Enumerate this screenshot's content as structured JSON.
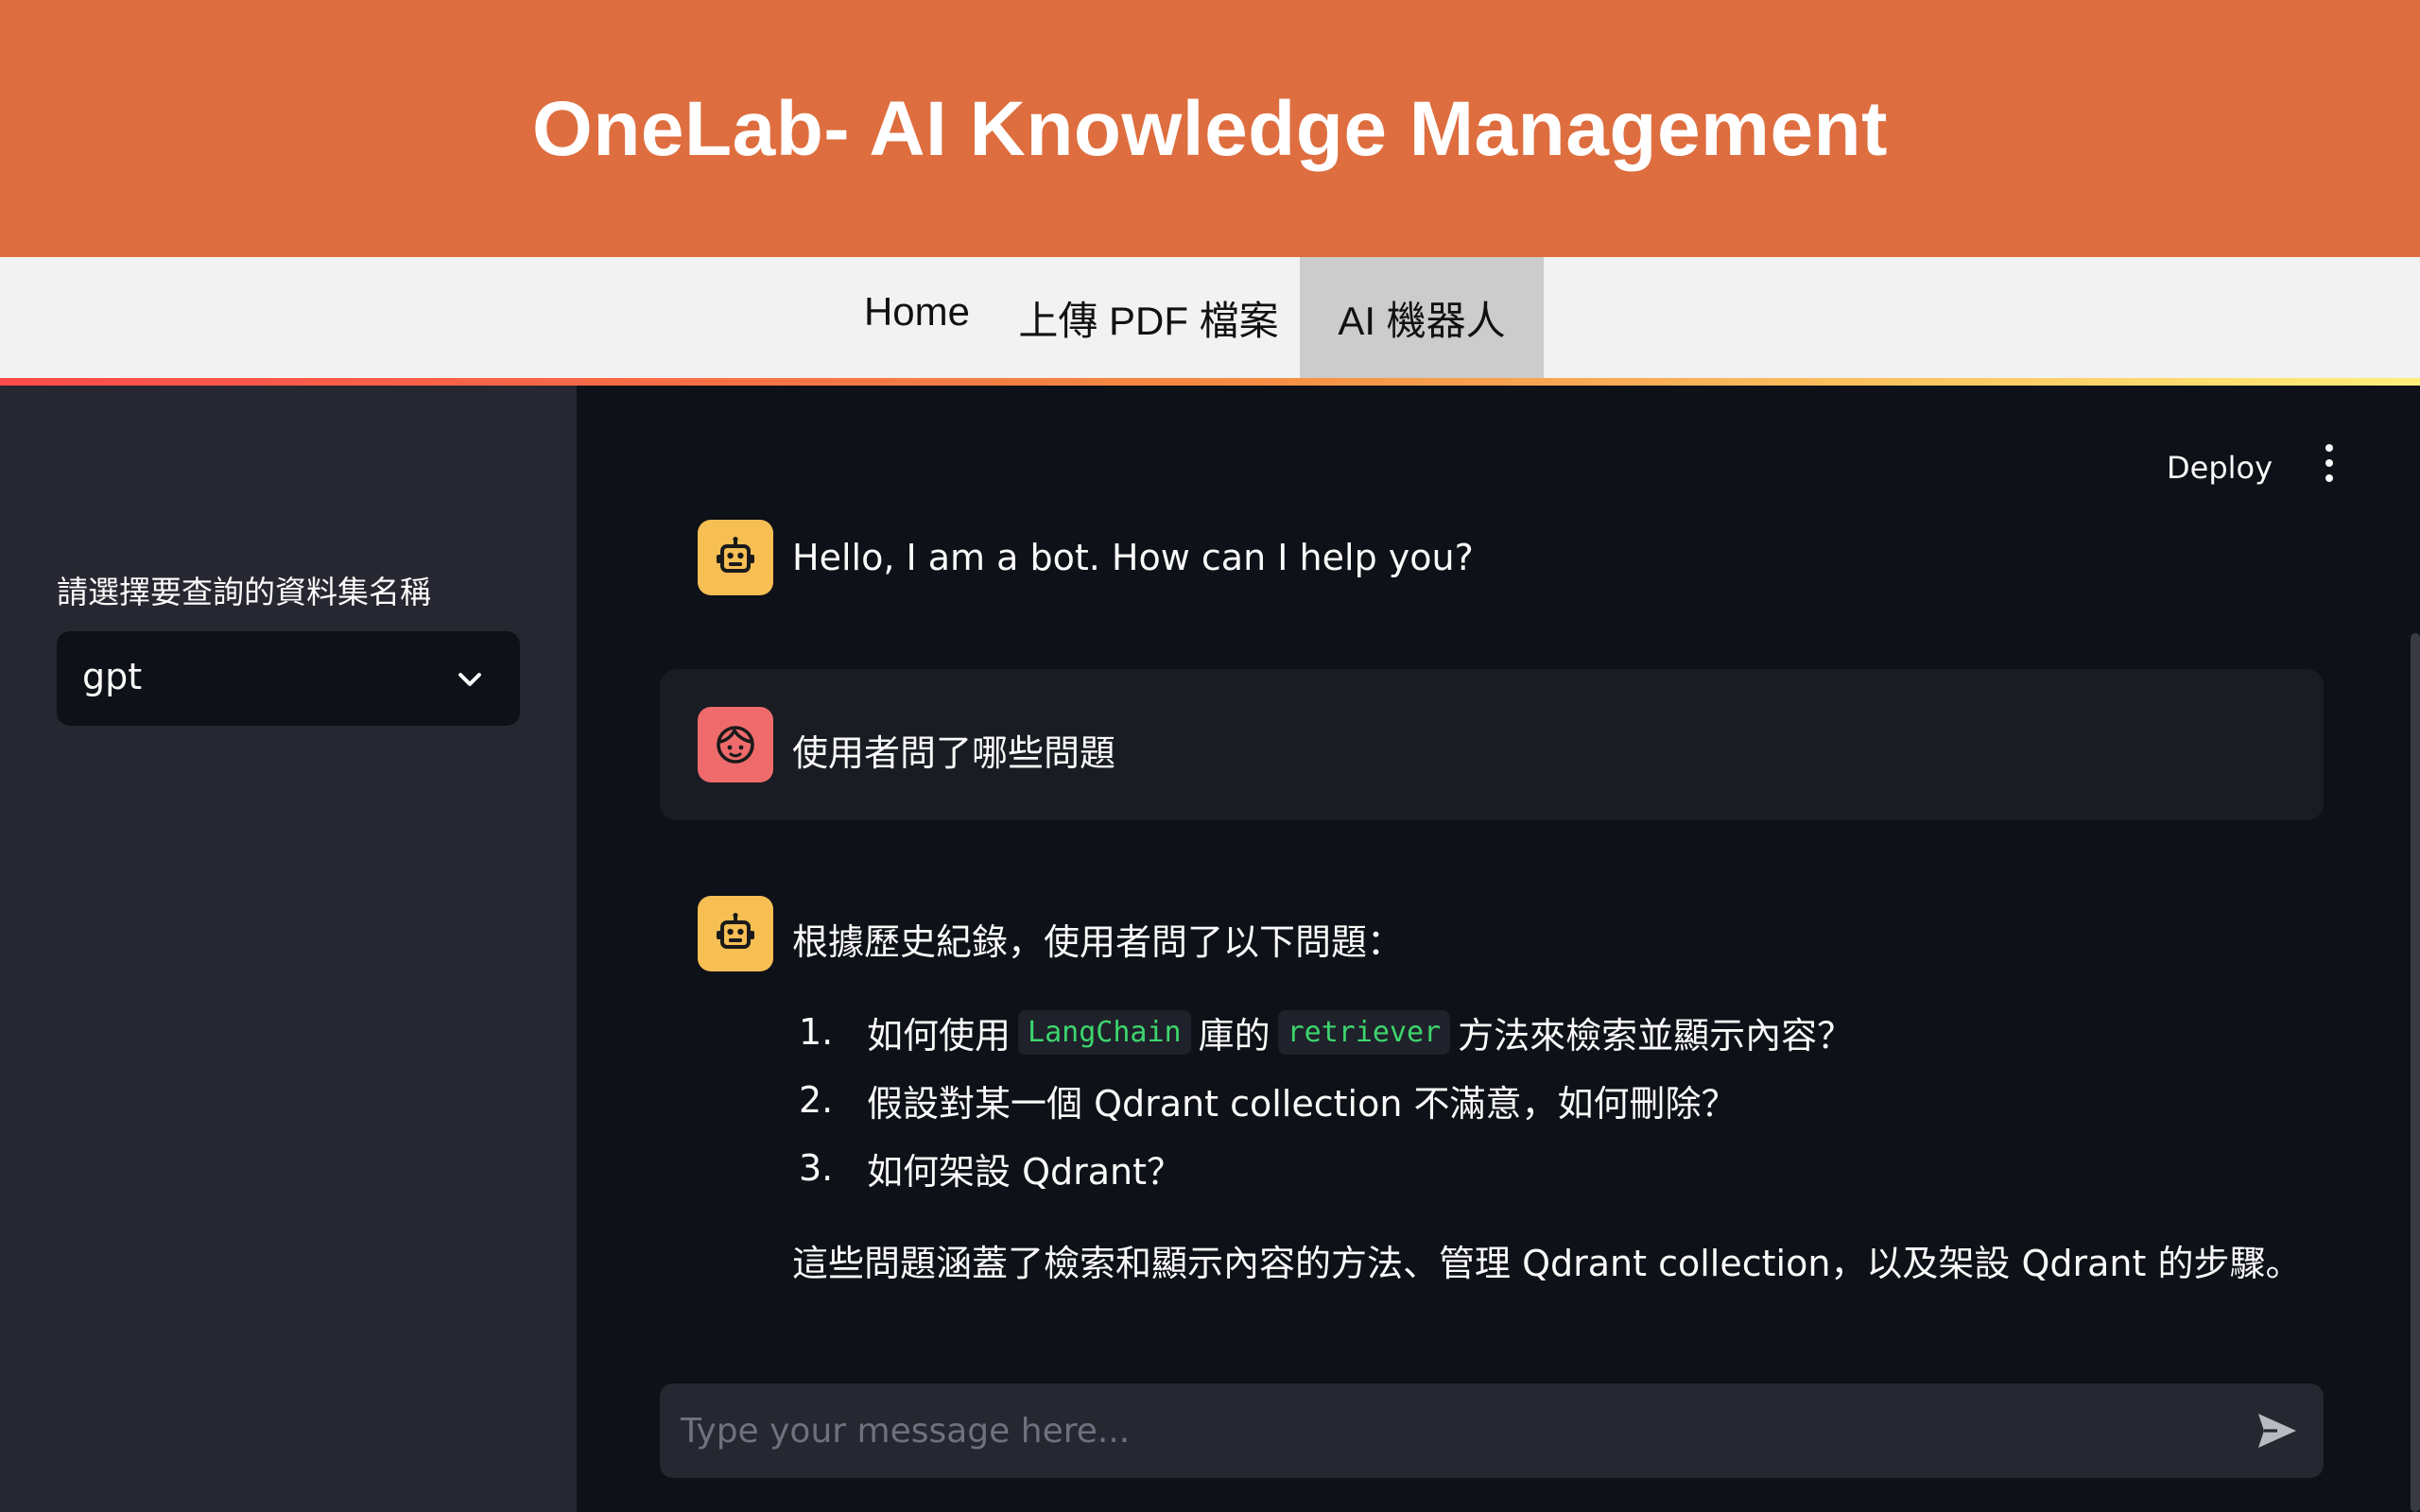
{
  "header": {
    "title": "OneLab- AI Knowledge Management"
  },
  "nav": {
    "tabs": [
      {
        "label": "Home"
      },
      {
        "label": "上傳 PDF 檔案"
      },
      {
        "label": "AI 機器人"
      }
    ],
    "active_tab": "AI 機器人"
  },
  "sidebar": {
    "select_label": "請選擇要查詢的資料集名稱",
    "select_value": "gpt",
    "select_icon": "chevron-down-icon"
  },
  "toolbar": {
    "deploy_label": "Deploy",
    "menu_icon": "more-vertical-icon"
  },
  "chat": {
    "messages": [
      {
        "role": "bot",
        "icon": "robot-icon",
        "text": "Hello, I am a bot. How can I help you?"
      },
      {
        "role": "user",
        "icon": "face-icon",
        "text": "使用者問了哪些問題"
      },
      {
        "role": "bot",
        "icon": "robot-icon",
        "intro": "根據歷史紀錄，使用者問了以下問題：",
        "items": [
          {
            "num": "1.",
            "pre": "如何使用",
            "code1": "LangChain",
            "mid": "庫的",
            "code2": "retriever",
            "post": "方法來檢索並顯示內容？"
          },
          {
            "num": "2.",
            "text": "假設對某一個 Qdrant collection 不滿意，如何刪除？"
          },
          {
            "num": "3.",
            "text": "如何架設 Qdrant？"
          }
        ],
        "summary": "這些問題涵蓋了檢索和顯示內容的方法、管理 Qdrant collection，以及架設 Qdrant 的步驟。"
      }
    ],
    "input_placeholder": "Type your message here...",
    "input_value": "",
    "send_icon": "send-icon"
  },
  "colors": {
    "header_bg": "#de6e3f",
    "nav_bg": "#f2f2f2",
    "active_tab_bg": "#cccccc",
    "sidebar_bg": "#262730",
    "main_bg": "#0e1117",
    "bot_avatar": "#f7be54",
    "user_avatar": "#ef6b6b",
    "code_text": "#3dd56d"
  }
}
